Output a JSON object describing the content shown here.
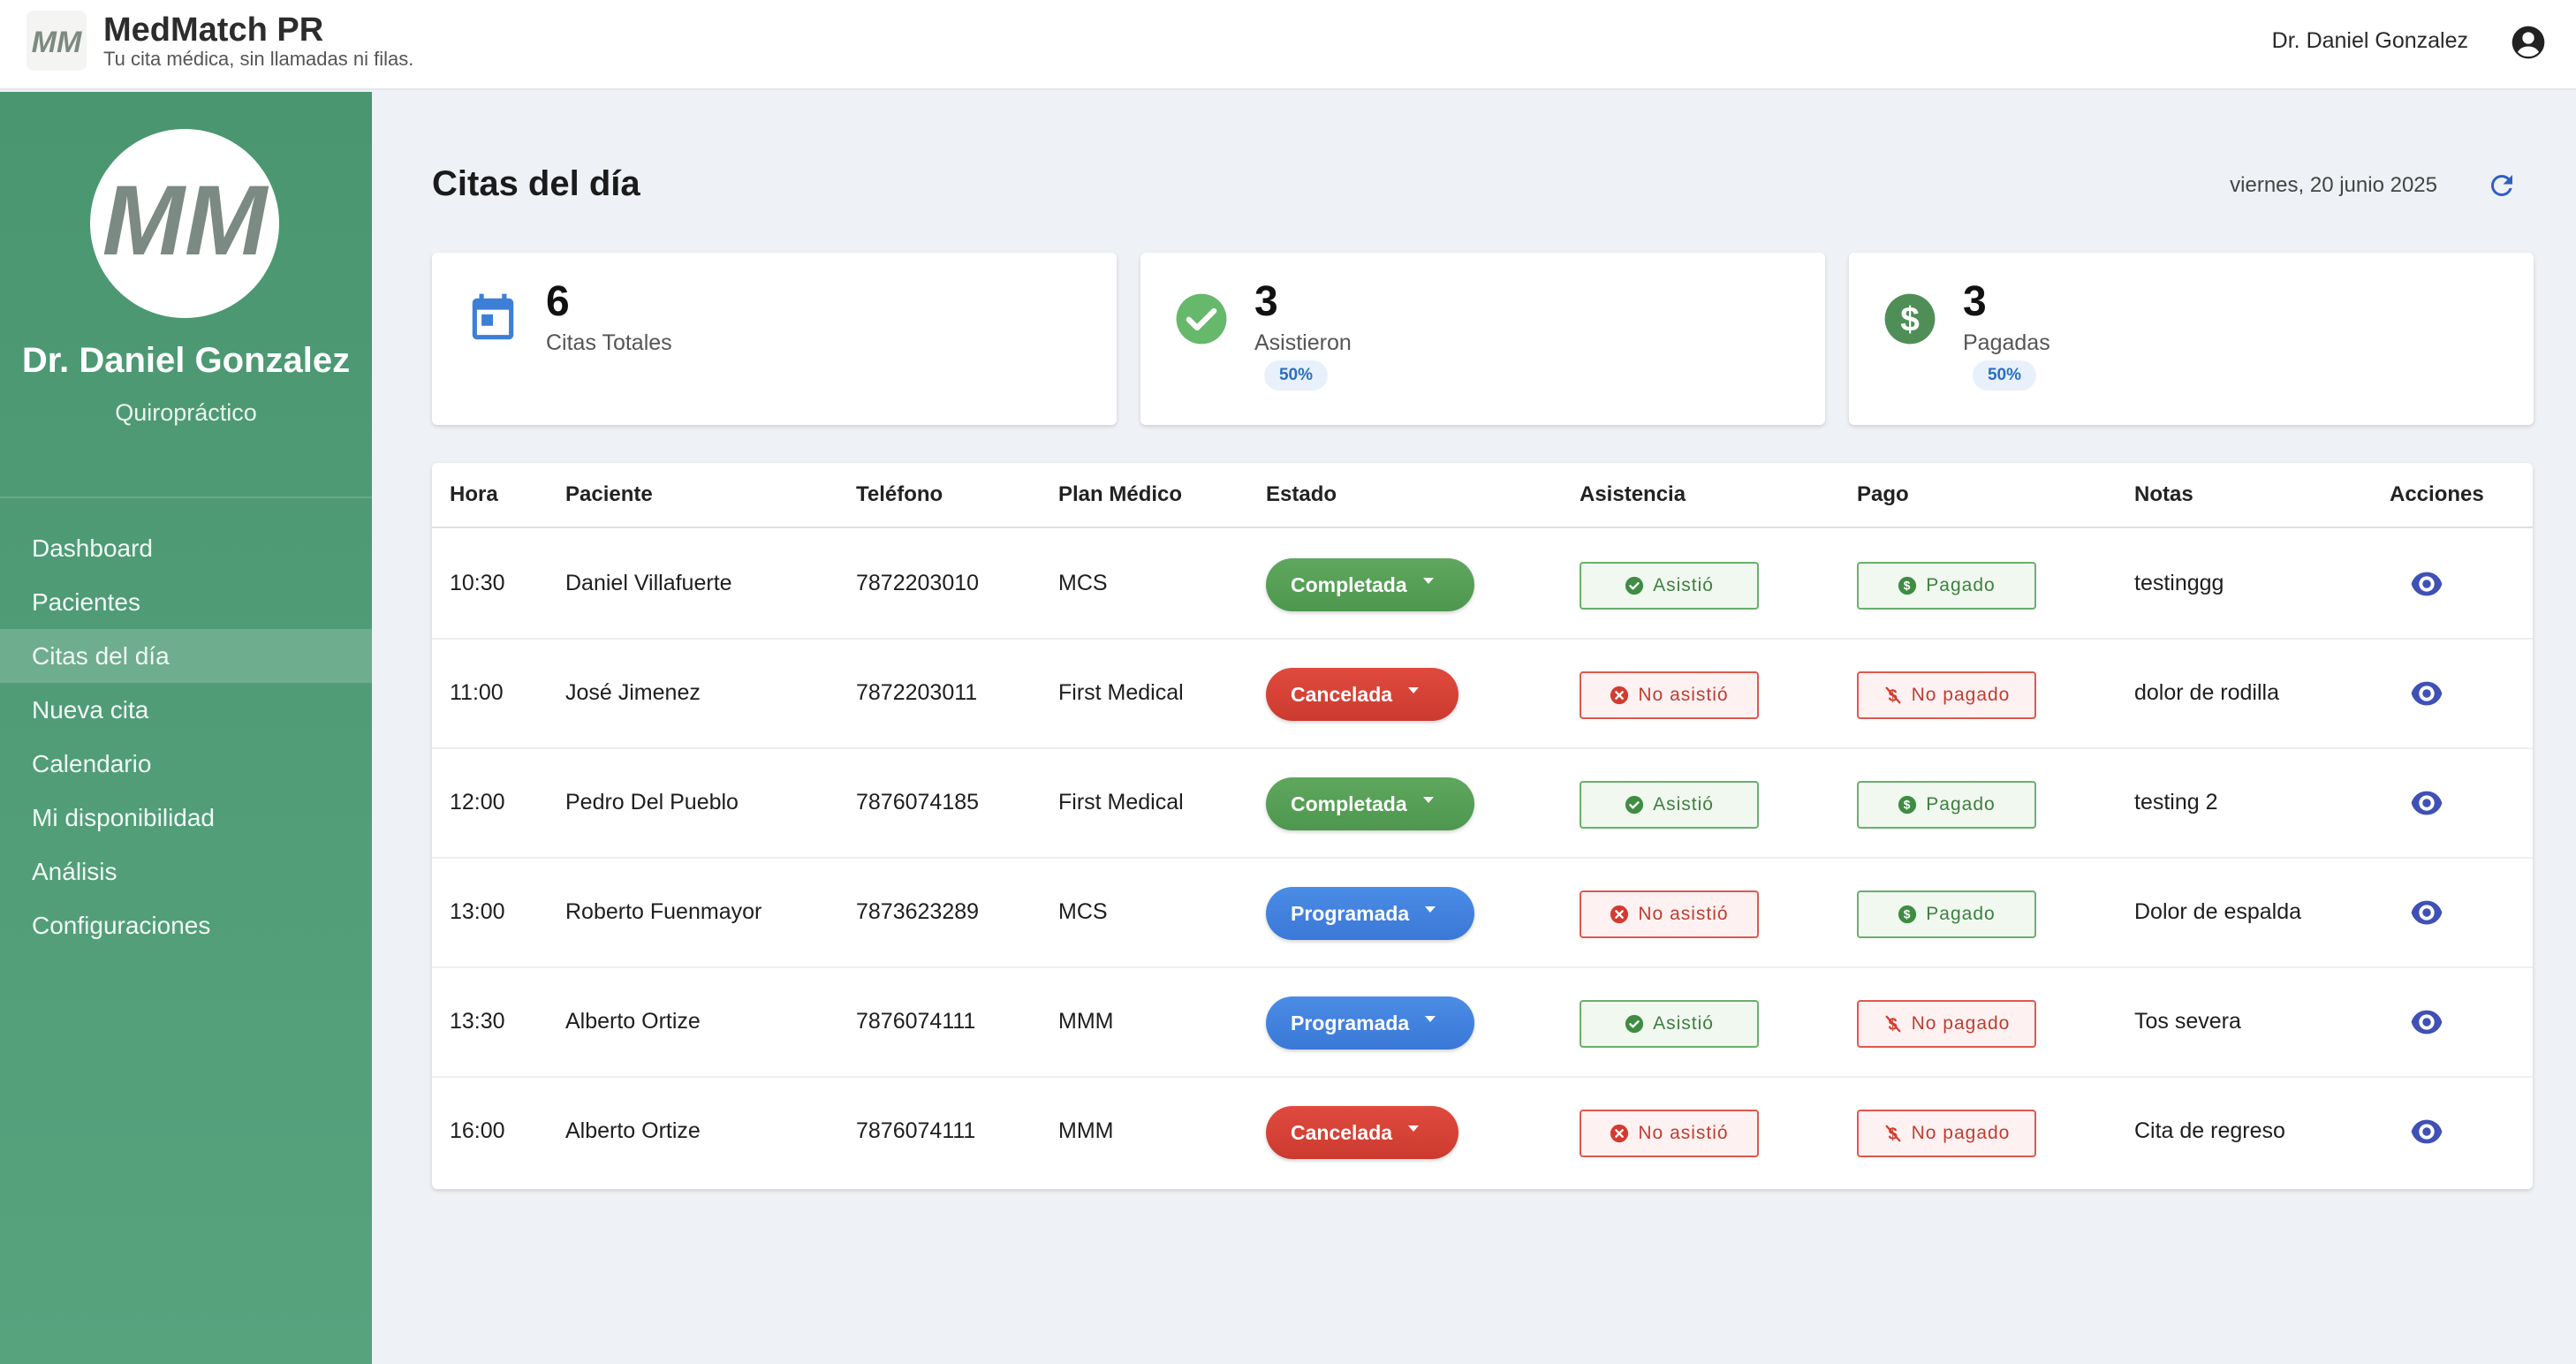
{
  "app": {
    "name": "MedMatch PR",
    "tagline": "Tu cita médica, sin llamadas ni filas.",
    "user_name": "Dr. Daniel Gonzalez"
  },
  "sidebar": {
    "doctor_name": "Dr. Daniel Gonzalez",
    "specialty": "Quiropráctico",
    "items": [
      {
        "label": "Dashboard",
        "active": false
      },
      {
        "label": "Pacientes",
        "active": false
      },
      {
        "label": "Citas del día",
        "active": true
      },
      {
        "label": "Nueva cita",
        "active": false
      },
      {
        "label": "Calendario",
        "active": false
      },
      {
        "label": "Mi disponibilidad",
        "active": false
      },
      {
        "label": "Análisis",
        "active": false
      },
      {
        "label": "Configuraciones",
        "active": false
      }
    ]
  },
  "header": {
    "title": "Citas del día",
    "date": "viernes, 20 junio 2025"
  },
  "stats": [
    {
      "value": "6",
      "label": "Citas Totales",
      "icon": "calendar-icon",
      "pill": ""
    },
    {
      "value": "3",
      "label": "Asistieron",
      "icon": "check-circle-icon",
      "pill": "50%"
    },
    {
      "value": "3",
      "label": "Pagadas",
      "icon": "dollar-circle-icon",
      "pill": "50%"
    }
  ],
  "table": {
    "columns": [
      "Hora",
      "Paciente",
      "Teléfono",
      "Plan Médico",
      "Estado",
      "Asistencia",
      "Pago",
      "Notas",
      "Acciones"
    ],
    "rows": [
      {
        "hora": "10:30",
        "paciente": "Daniel Villafuerte",
        "telefono": "7872203010",
        "plan": "MCS",
        "estado": "Completada",
        "asistencia": "Asistió",
        "pago": "Pagado",
        "notas": "testinggg"
      },
      {
        "hora": "11:00",
        "paciente": "José Jimenez",
        "telefono": "7872203011",
        "plan": "First Medical",
        "estado": "Cancelada",
        "asistencia": "No asistió",
        "pago": "No pagado",
        "notas": "dolor de rodilla"
      },
      {
        "hora": "12:00",
        "paciente": "Pedro Del Pueblo",
        "telefono": "7876074185",
        "plan": "First Medical",
        "estado": "Completada",
        "asistencia": "Asistió",
        "pago": "Pagado",
        "notas": "testing 2"
      },
      {
        "hora": "13:00",
        "paciente": "Roberto Fuenmayor",
        "telefono": "7873623289",
        "plan": "MCS",
        "estado": "Programada",
        "asistencia": "No asistió",
        "pago": "Pagado",
        "notas": "Dolor de espalda"
      },
      {
        "hora": "13:30",
        "paciente": "Alberto Ortize",
        "telefono": "7876074111",
        "plan": "MMM",
        "estado": "Programada",
        "asistencia": "Asistió",
        "pago": "No pagado",
        "notas": "Tos severa"
      },
      {
        "hora": "16:00",
        "paciente": "Alberto Ortize",
        "telefono": "7876074111",
        "plan": "MMM",
        "estado": "Cancelada",
        "asistencia": "No asistió",
        "pago": "No pagado",
        "notas": "Cita de regreso"
      }
    ]
  },
  "colors": {
    "sidebar": "#4a9670",
    "completada": "#56a056",
    "cancelada": "#d6423a",
    "programada": "#4383de",
    "action": "#3f51b5"
  }
}
